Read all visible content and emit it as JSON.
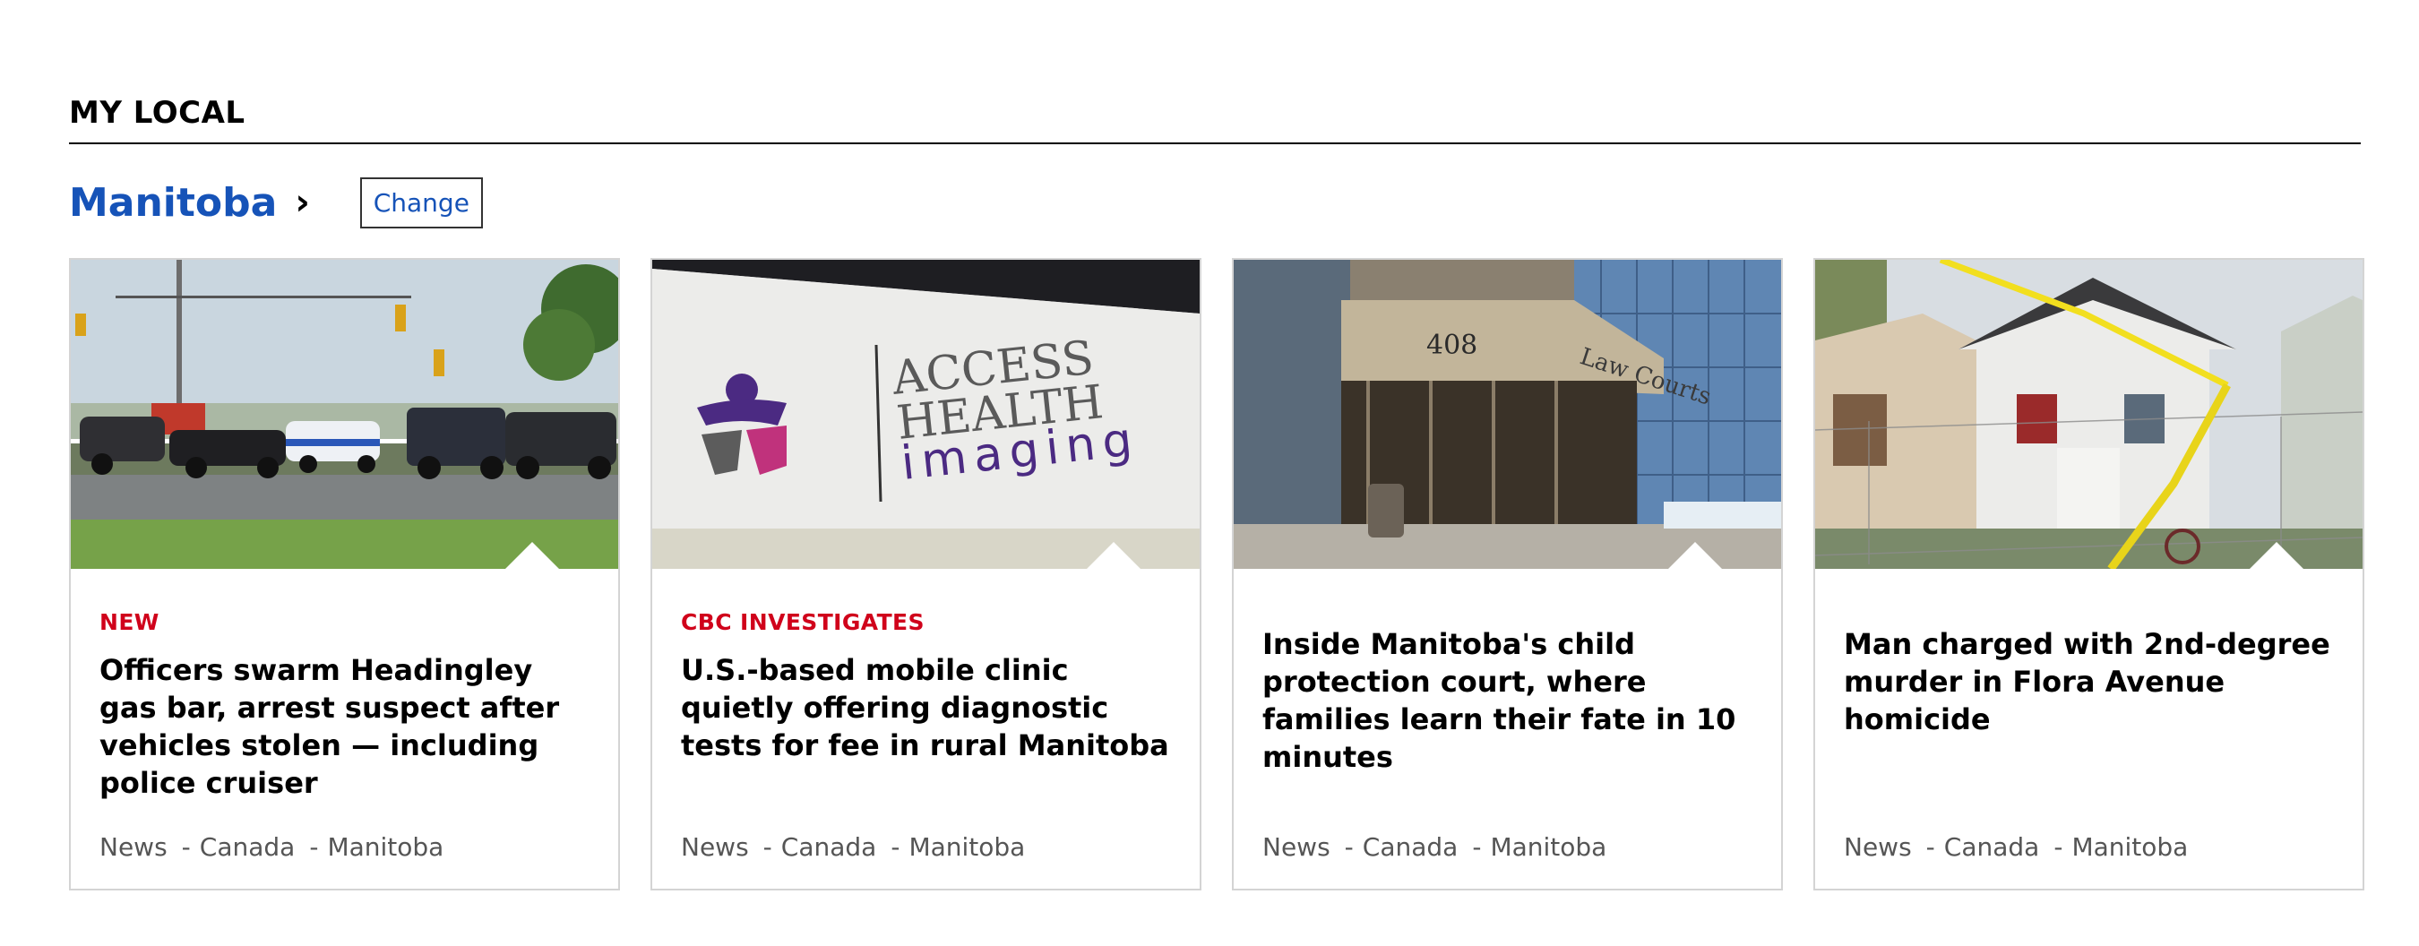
{
  "section": {
    "title": "MY LOCAL"
  },
  "region": {
    "name": "Manitoba",
    "chevron": "›",
    "change_label": "Change"
  },
  "cards": [
    {
      "label": "NEW",
      "headline": "Officers swarm Headingley gas bar, arrest suspect after vehicles stolen — including police cruiser",
      "tags": [
        "News",
        "Canada",
        "Manitoba"
      ],
      "image": "police-vehicles-roadside-photo"
    },
    {
      "label": "CBC INVESTIGATES",
      "headline": "U.S.-based mobile clinic quietly offering diagnostic tests for fee in rural Manitoba",
      "tags": [
        "News",
        "Canada",
        "Manitoba"
      ],
      "image": "access-health-imaging-logo-photo",
      "logo_text": [
        "ACCESS",
        "HEALTH",
        "imaging"
      ]
    },
    {
      "label": "",
      "headline": "Inside Manitoba's child protection court, where families learn their fate in 10 minutes",
      "tags": [
        "News",
        "Canada",
        "Manitoba"
      ],
      "image": "law-courts-building-photo",
      "sign_number": "408",
      "sign_text": "Law Courts"
    },
    {
      "label": "",
      "headline": "Man charged with 2nd-degree murder in Flora Avenue homicide",
      "tags": [
        "News",
        "Canada",
        "Manitoba"
      ],
      "image": "house-crime-scene-tape-photo"
    }
  ],
  "colors": {
    "region_link": "#1653b8",
    "label_red": "#d0021b",
    "tag_gray": "#555555"
  }
}
